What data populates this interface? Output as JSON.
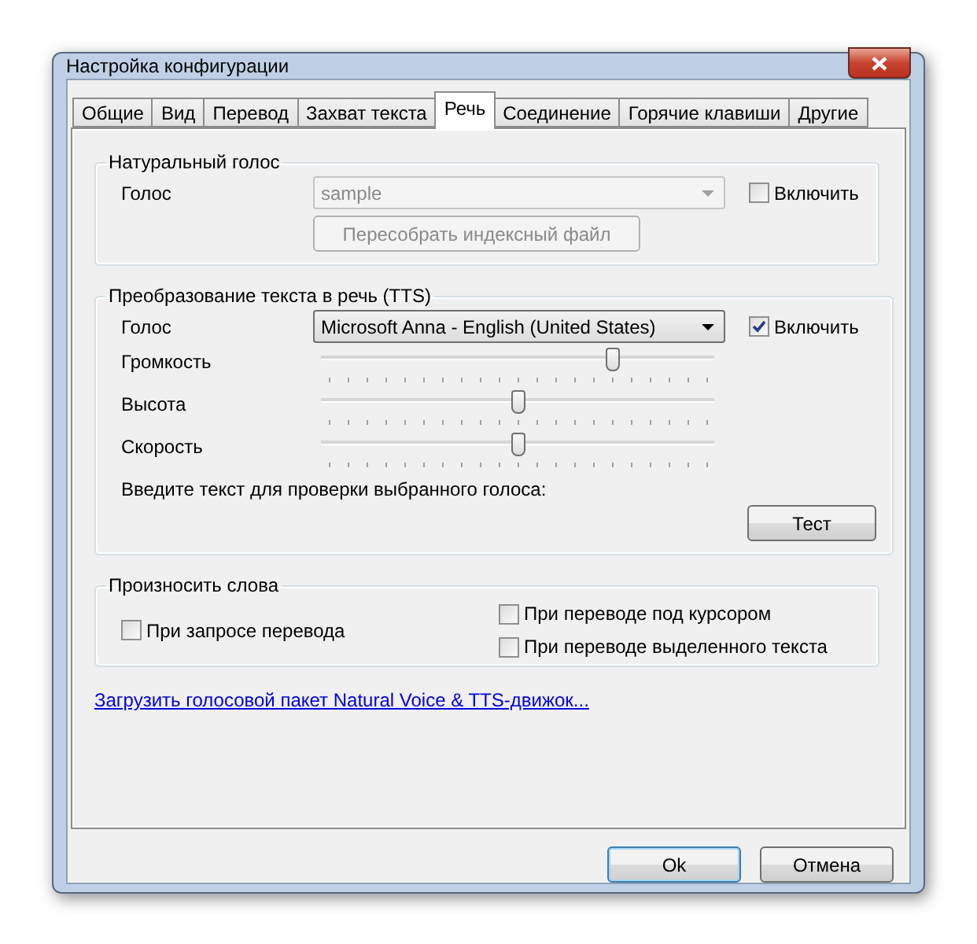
{
  "window": {
    "title": "Настройка конфигурации"
  },
  "tabs": [
    {
      "label": "Общие",
      "selected": false
    },
    {
      "label": "Вид",
      "selected": false
    },
    {
      "label": "Перевод",
      "selected": false
    },
    {
      "label": "Захват текста",
      "selected": false
    },
    {
      "label": "Речь",
      "selected": true
    },
    {
      "label": "Соединение",
      "selected": false
    },
    {
      "label": "Горячие клавиши",
      "selected": false
    },
    {
      "label": "Другие",
      "selected": false
    }
  ],
  "natural_voice": {
    "title": "Натуральный голос",
    "voice_label": "Голос",
    "voice_value": "sample",
    "disabled": true,
    "enable": {
      "label": "Включить",
      "checked": false
    },
    "rebuild_button": "Пересобрать индексный файл"
  },
  "tts": {
    "title": "Преобразование текста в речь (TTS)",
    "voice_label": "Голос",
    "voice_value": "Microsoft Anna - English (United States)",
    "disabled": false,
    "enable": {
      "label": "Включить",
      "checked": true
    },
    "sliders": [
      {
        "label": "Громкость",
        "level": 0.75
      },
      {
        "label": "Высота",
        "level": 0.5
      },
      {
        "label": "Скорость",
        "level": 0.5
      }
    ],
    "prompt": "Введите текст для проверки выбранного голоса:",
    "test_button": "Тест"
  },
  "pronounce": {
    "title": "Произносить слова",
    "options": [
      {
        "label": "При запросе перевода",
        "checked": false
      },
      {
        "label": "При переводе под курсором",
        "checked": false
      },
      {
        "label": "При переводе выделенного текста",
        "checked": false
      }
    ]
  },
  "link": "Загрузить голосовой пакет Natural Voice & TTS-движок...",
  "buttons": [
    {
      "label": "Ok",
      "default": true
    },
    {
      "label": "Отмена",
      "default": false
    }
  ]
}
